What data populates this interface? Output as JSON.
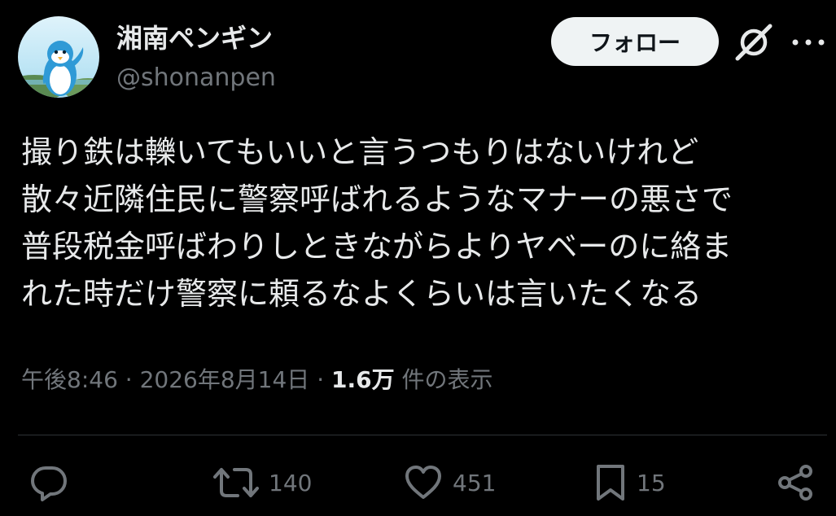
{
  "user": {
    "display_name": "湘南ペンギン",
    "handle": "@shonanpen"
  },
  "header": {
    "follow_label": "フォロー"
  },
  "tweet": {
    "lines": [
      "撮り鉄は轢いてもいいと言うつもりはないけれど",
      "散々近隣住民に警察呼ばれるようなマナーの悪さで",
      "普段税金呼ばわりしときながらよりヤベーのに絡ま",
      "れた時だけ警察に頼るなよくらいは言いたくなる"
    ]
  },
  "meta": {
    "time": "午後8:46",
    "separator1": " · ",
    "date": "2026年8月14日",
    "separator2": " · ",
    "views_count": "1.6万",
    "views_label": " 件の表示"
  },
  "actions": {
    "reply_count": "",
    "retweet_count": "140",
    "like_count": "451",
    "bookmark_count": "15"
  },
  "icons": {
    "avatar": "penguin-avatar",
    "grok": "grok-icon",
    "more": "more-icon",
    "reply": "reply-icon",
    "retweet": "retweet-icon",
    "like": "heart-icon",
    "bookmark": "bookmark-icon",
    "share": "share-icon"
  },
  "colors": {
    "background": "#000000",
    "text": "#e7e9ea",
    "secondary_text": "#71767b",
    "follow_button_bg": "#eff3f4",
    "follow_button_text": "#0f1419",
    "divider": "#2f3336"
  }
}
